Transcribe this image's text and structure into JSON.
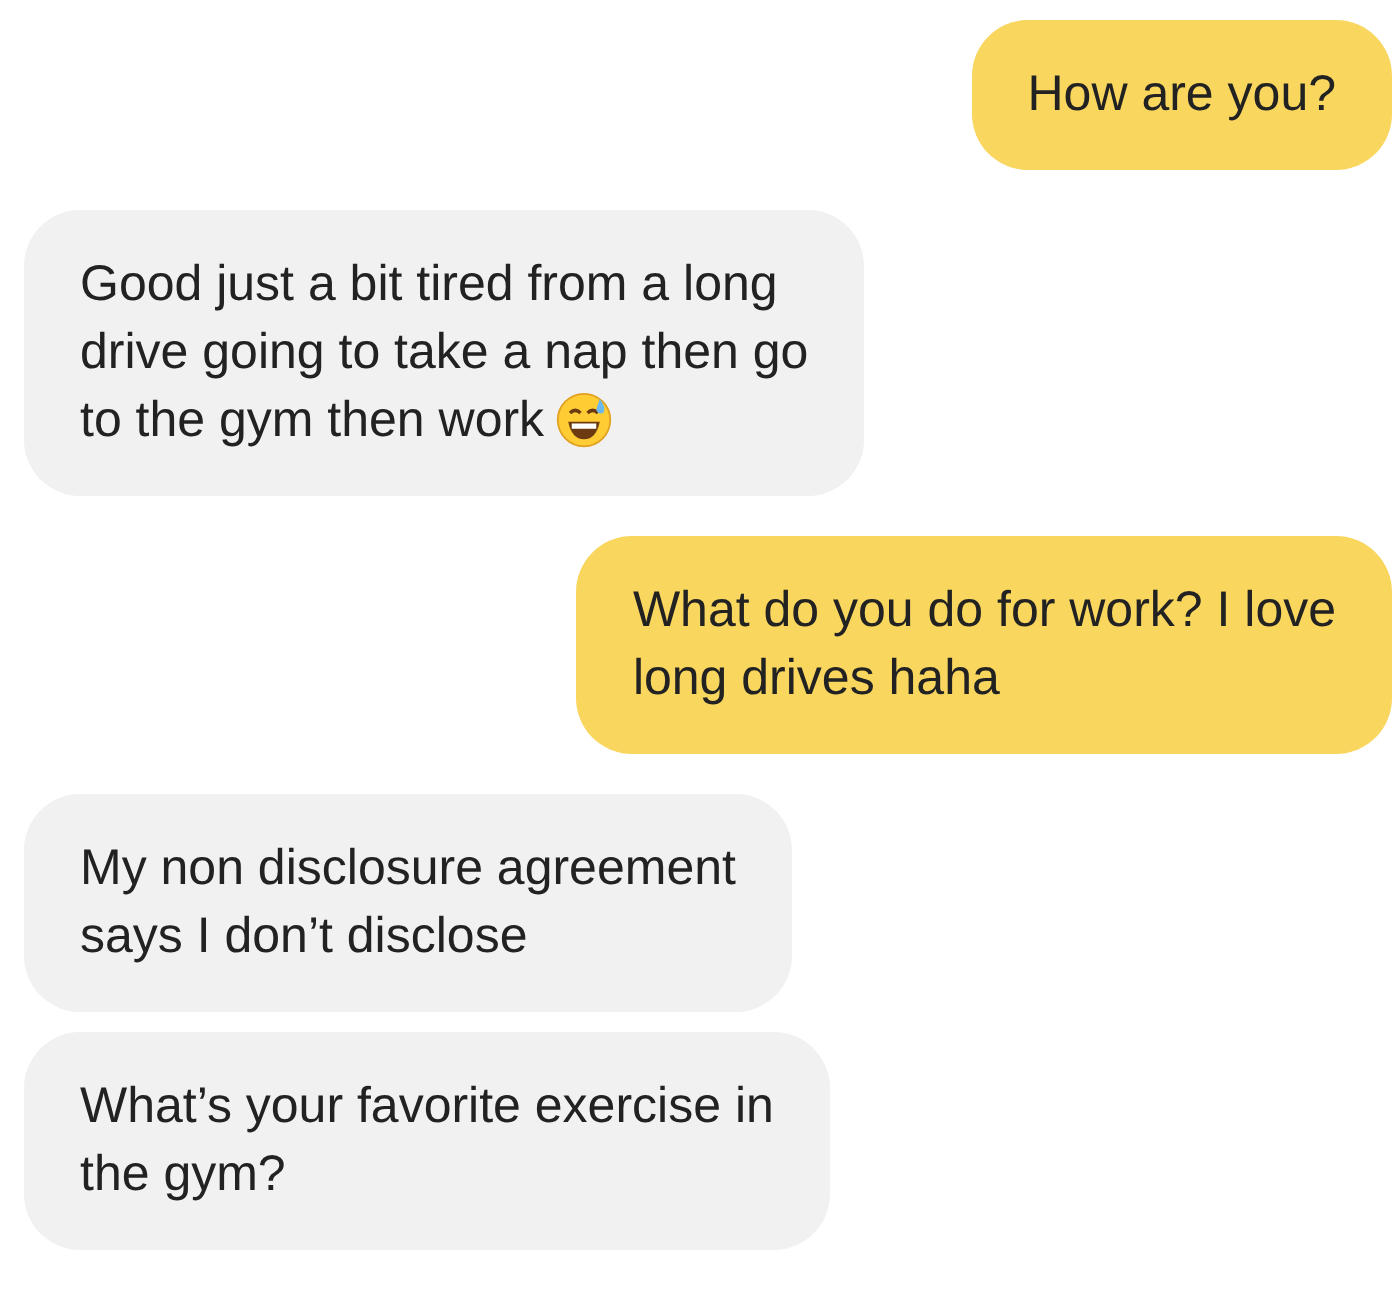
{
  "messages": [
    {
      "kind": "outgoing",
      "lines": [
        "How are you?"
      ]
    },
    {
      "kind": "incoming",
      "lines": [
        "Good just a bit tired from a long",
        "drive going to take a nap then go",
        "to the gym then work"
      ],
      "emoji": true
    },
    {
      "kind": "outgoing",
      "lines": [
        "What do you do for work? I love",
        "long drives haha"
      ]
    },
    {
      "kind": "incoming",
      "lines": [
        "My non disclosure agreement",
        "says I don’t disclose"
      ]
    },
    {
      "kind": "incoming",
      "lines": [
        "What’s your favorite exercise in",
        "the gym?"
      ]
    }
  ]
}
